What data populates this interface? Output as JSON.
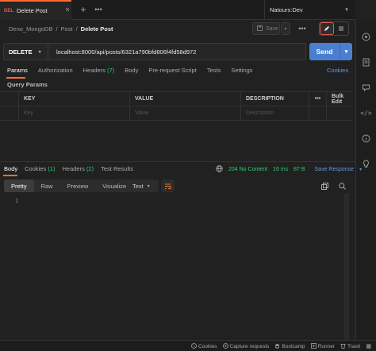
{
  "tabs": [
    {
      "method": "DEL",
      "title": "Delete Post"
    }
  ],
  "environment": "Natours:Dev",
  "breadcrumb": {
    "collection": "Deno_MongoDB",
    "folder": "Post",
    "request": "Delete Post"
  },
  "save_label": "Save",
  "request": {
    "method": "DELETE",
    "url": "localhost:8000/api/posts/6321a790bfd806f4fd58d972"
  },
  "send_label": "Send",
  "request_tabs": {
    "params": "Params",
    "authorization": "Authorization",
    "headers": "Headers",
    "headers_count": "(7)",
    "body": "Body",
    "pre_request": "Pre-request Script",
    "tests": "Tests",
    "settings": "Settings",
    "cookies": "Cookies"
  },
  "query_params": {
    "title": "Query Params",
    "columns": {
      "key": "KEY",
      "value": "VALUE",
      "description": "DESCRIPTION",
      "bulk_edit": "Bulk Edit"
    },
    "placeholders": {
      "key": "Key",
      "value": "Value",
      "description": "Description"
    }
  },
  "response_tabs": {
    "body": "Body",
    "cookies": "Cookies",
    "cookies_count": "(1)",
    "headers": "Headers",
    "headers_count": "(2)",
    "test_results": "Test Results"
  },
  "response_status": {
    "status": "204 No Content",
    "time": "16 ms",
    "size": "87 B",
    "save_response": "Save Response"
  },
  "view_modes": [
    "Pretty",
    "Raw",
    "Preview",
    "Visualize"
  ],
  "format": "Text",
  "line_number": "1",
  "footer": {
    "cookies": "Cookies",
    "capture": "Capture requests",
    "bootcamp": "Bootcamp",
    "runner": "Runner",
    "trash": "Trash"
  },
  "colors": {
    "accent": "#ff6c37",
    "send": "#4a7fd0",
    "delete": "#e05b4b",
    "success": "#2ecc71",
    "link": "#5a9ce8"
  }
}
